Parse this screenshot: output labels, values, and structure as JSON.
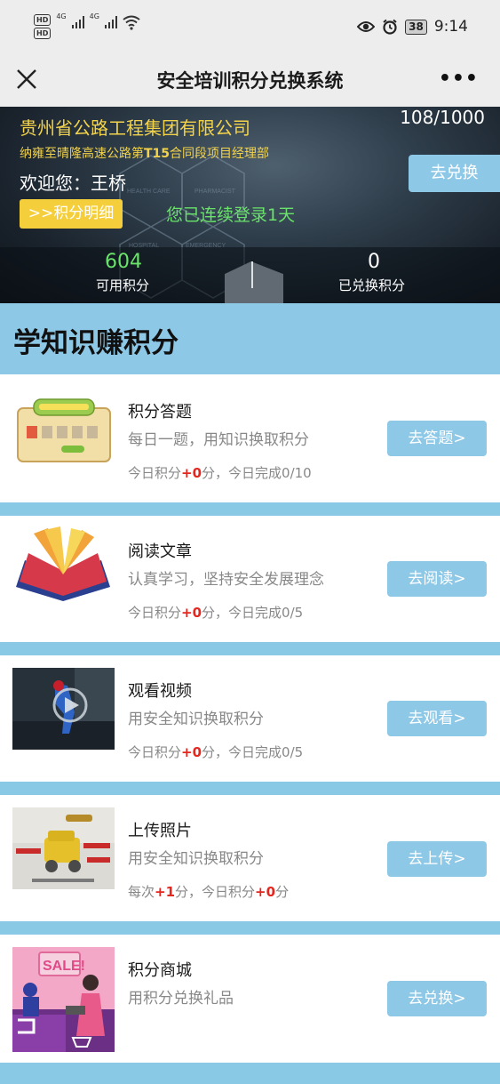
{
  "status_bar": {
    "hd1": "HD",
    "hd2": "HD",
    "net1": "4G",
    "net2": "4G",
    "battery": "38",
    "time": "9:14",
    "icons": [
      "eye-icon",
      "alarm-icon",
      "battery-icon",
      "wifi-icon",
      "signal-icon"
    ]
  },
  "nav": {
    "title": "安全培训积分兑换系统",
    "more": "•••"
  },
  "banner": {
    "company": "贵州省公路工程集团有限公司",
    "project_prefix": "纳雍至晴隆高速公路第",
    "project_code": "T15",
    "project_suffix": "合同段项目经理部",
    "welcome": "欢迎您：王桥",
    "detail_button": ">>积分明细",
    "login_note": "您已连续登录1天",
    "progress": "108/1000",
    "exchange_button": "去兑换",
    "available_points": "604",
    "available_label": "可用积分",
    "exchanged_points": "0",
    "exchanged_label": "已兑换积分",
    "bg_words": [
      "HEALTH CARE",
      "PHARMACIST",
      "HOSPITAL",
      "EMERGENCY"
    ]
  },
  "section": {
    "title": "学知识赚积分"
  },
  "colors": {
    "accent_blue": "#8ec8e7",
    "yellow": "#f5cf3b",
    "green": "#69e36a",
    "red": "#e3271f"
  },
  "cards": [
    {
      "title": "积分答题",
      "subtitle": "每日一题，用知识换取积分",
      "stat_a": "今日积分",
      "stat_a_val": "+0",
      "stat_b": "分，今日完成0/10",
      "stat_c": "",
      "stat_c_val": "",
      "stat_d": "",
      "button": "去答题>"
    },
    {
      "title": "阅读文章",
      "subtitle": "认真学习，坚持安全发展理念",
      "stat_a": "今日积分",
      "stat_a_val": "+0",
      "stat_b": "分，今日完成0/5",
      "stat_c": "",
      "stat_c_val": "",
      "stat_d": "",
      "button": "去阅读>"
    },
    {
      "title": "观看视频",
      "subtitle": "用安全知识换取积分",
      "stat_a": "今日积分",
      "stat_a_val": "+0",
      "stat_b": "分，今日完成0/5",
      "stat_c": "",
      "stat_c_val": "",
      "stat_d": "",
      "button": "去观看>"
    },
    {
      "title": "上传照片",
      "subtitle": "用安全知识换取积分",
      "stat_a": "每次",
      "stat_a_val": "+1",
      "stat_b": "分，今日积分",
      "stat_c_val": "+0",
      "stat_d": "分",
      "button": "去上传>"
    },
    {
      "title": "积分商城",
      "subtitle": "用积分兑换礼品",
      "button": "去兑换>"
    }
  ]
}
